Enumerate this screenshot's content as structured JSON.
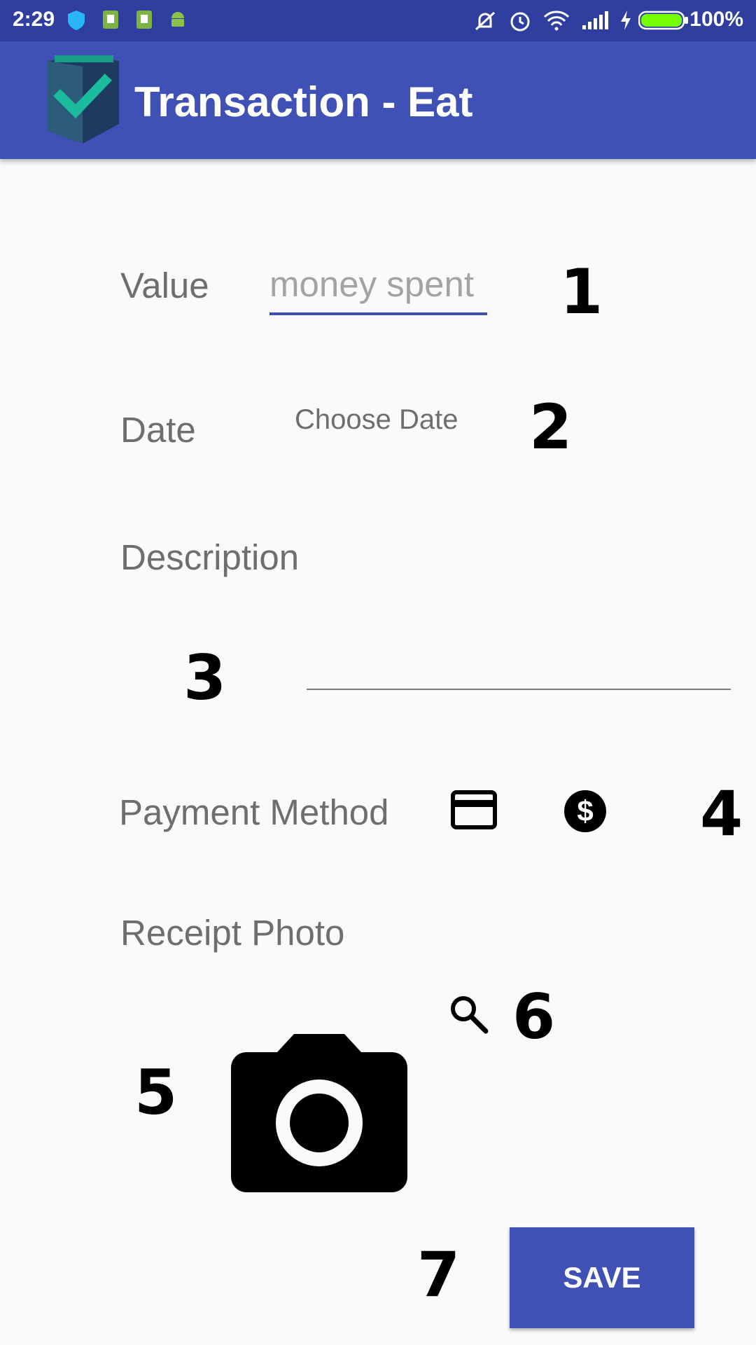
{
  "status_bar": {
    "time": "2:29",
    "battery_percent": "100%",
    "battery_level": 1.0
  },
  "toolbar": {
    "title": "Transaction - Eat"
  },
  "form": {
    "value_label": "Value",
    "value_placeholder": "money spent",
    "date_label": "Date",
    "date_button": "Choose Date",
    "description_label": "Description",
    "payment_label": "Payment Method",
    "receipt_label": "Receipt Photo",
    "save_label": "SAVE"
  },
  "annotations": [
    "1",
    "2",
    "3",
    "4",
    "5",
    "6",
    "7"
  ],
  "colors": {
    "primary": "#3f51b5",
    "primary_dark": "#303f9f",
    "background": "#fafafa",
    "label_text": "#6e6e6e",
    "hint_text": "#a3a3a3"
  }
}
